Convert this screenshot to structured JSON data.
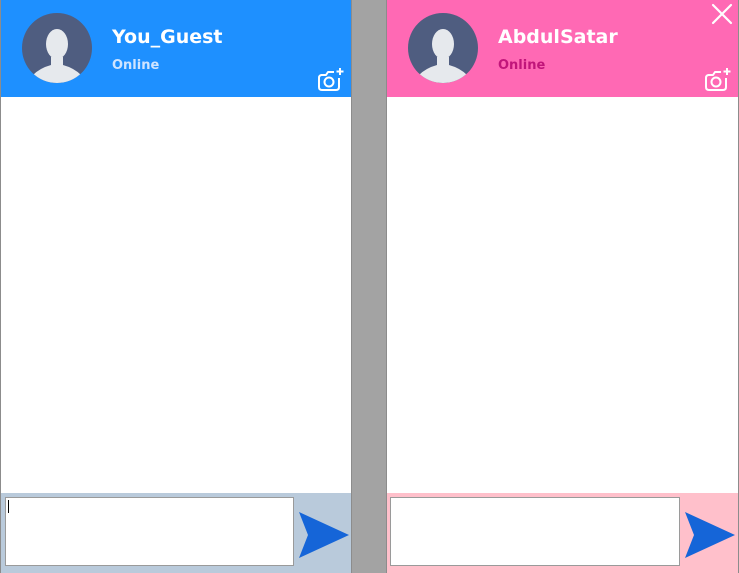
{
  "colors": {
    "divider_bg": "#a3a3a3",
    "left_header_bg": "#1e90ff",
    "right_header_bg": "#ff69b4",
    "left_footer_bg": "#b9cadb",
    "right_footer_bg": "#ffc0cb",
    "send_arrow": "#1565d8",
    "avatar_bg": "#4f5d80",
    "avatar_figure": "#e6e9ed"
  },
  "left_chat": {
    "user_name": "You_Guest",
    "status": "Online",
    "avatar_icon": "user-silhouette-icon",
    "camera_icon": "add-camera-icon",
    "send_icon": "send-arrow-icon",
    "input_value": ""
  },
  "right_chat": {
    "user_name": "AbdulSatar",
    "status": "Online",
    "avatar_icon": "user-silhouette-icon",
    "camera_icon": "add-camera-icon",
    "close_icon": "close-x-icon",
    "send_icon": "send-arrow-icon",
    "input_value": ""
  }
}
